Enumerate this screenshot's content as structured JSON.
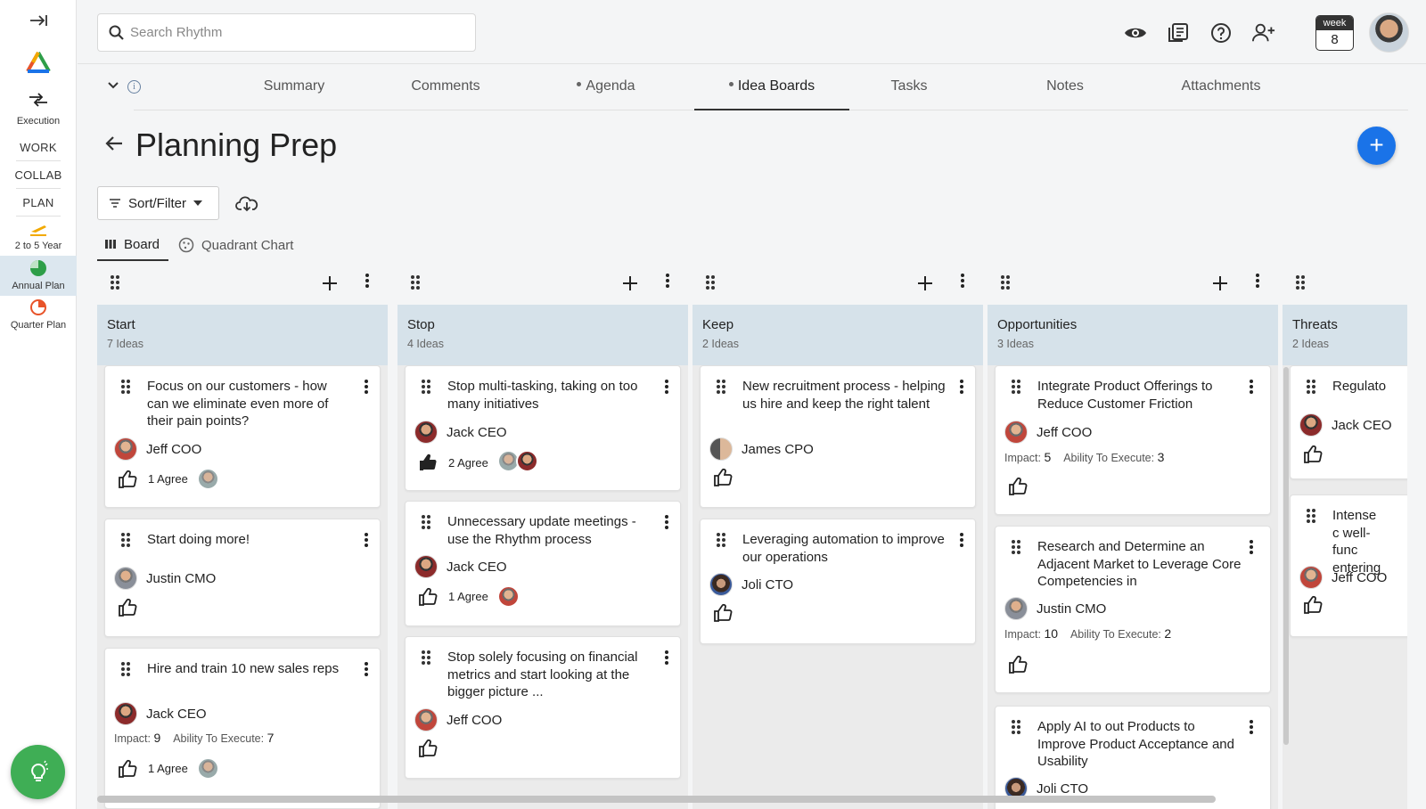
{
  "sidebar": {
    "sections": [
      "Execution",
      "WORK",
      "COLLAB",
      "PLAN"
    ],
    "plan_items": [
      {
        "label": "2 to 5 Year",
        "icon": "runway-icon",
        "color": "#f2a900"
      },
      {
        "label": "Annual Plan",
        "icon": "pie-chart-icon",
        "color": "#2e9e48"
      },
      {
        "label": "Quarter Plan",
        "icon": "quarter-pie-icon",
        "color": "#e8542a"
      }
    ]
  },
  "topbar": {
    "search_placeholder": "Search Rhythm",
    "week_label": "week",
    "week_number": "8"
  },
  "tabs": [
    {
      "label": "Summary",
      "dot": false
    },
    {
      "label": "Comments",
      "dot": false
    },
    {
      "label": "Agenda",
      "dot": true
    },
    {
      "label": "Idea Boards",
      "dot": true,
      "active": true
    },
    {
      "label": "Tasks",
      "dot": false
    },
    {
      "label": "Notes",
      "dot": false
    },
    {
      "label": "Attachments",
      "dot": false
    }
  ],
  "page": {
    "title": "Planning Prep",
    "sort_filter_label": "Sort/Filter",
    "view_tabs": [
      "Board",
      "Quadrant Chart"
    ]
  },
  "columns": [
    {
      "name": "Start",
      "count": "7 Ideas",
      "cards": [
        {
          "title": "Focus on our customers - how can we eliminate even more of their pain points?",
          "owner": "Jeff COO",
          "agree": "1 Agree"
        },
        {
          "title": "Start doing more!",
          "owner": "Justin CMO",
          "agree": ""
        },
        {
          "title": "Hire and train 10 new sales reps",
          "owner": "Jack CEO",
          "impact_label": "Impact:",
          "impact": "9",
          "ability_label": "Ability To Execute:",
          "ability": "7",
          "agree": "1 Agree"
        }
      ]
    },
    {
      "name": "Stop",
      "count": "4 Ideas",
      "cards": [
        {
          "title": "Stop multi-tasking, taking on too many initiatives",
          "owner": "Jack CEO",
          "agree": "2 Agree"
        },
        {
          "title": "Unnecessary update meetings - use the Rhythm process",
          "owner": "Jack CEO",
          "agree": "1 Agree"
        },
        {
          "title": "Stop solely focusing on financial metrics and start looking at the bigger picture ...",
          "owner": "Jeff COO",
          "agree": ""
        }
      ]
    },
    {
      "name": "Keep",
      "count": "2 Ideas",
      "cards": [
        {
          "title": "New recruitment process - helping us hire and keep the right talent",
          "owner": "James CPO",
          "agree": ""
        },
        {
          "title": "Leveraging automation to improve our operations",
          "owner": "Joli CTO",
          "agree": ""
        }
      ]
    },
    {
      "name": "Opportunities",
      "count": "3 Ideas",
      "cards": [
        {
          "title": "Integrate Product Offerings to Reduce Customer Friction",
          "owner": "Jeff COO",
          "impact_label": "Impact:",
          "impact": "5",
          "ability_label": "Ability To Execute:",
          "ability": "3"
        },
        {
          "title": "Research and Determine an Adjacent Market to Leverage Core Competencies in",
          "owner": "Justin CMO",
          "impact_label": "Impact:",
          "impact": "10",
          "ability_label": "Ability To Execute:",
          "ability": "2"
        },
        {
          "title": "Apply AI to out Products to Improve Product Acceptance and Usability",
          "owner": "Joli CTO"
        }
      ]
    },
    {
      "name": "Threats",
      "count": "2 Ideas",
      "cards": [
        {
          "title": "Regulato",
          "owner": "Jack CEO"
        },
        {
          "title": "Intense c well-func entering",
          "owner": "Jeff COO"
        }
      ]
    }
  ]
}
